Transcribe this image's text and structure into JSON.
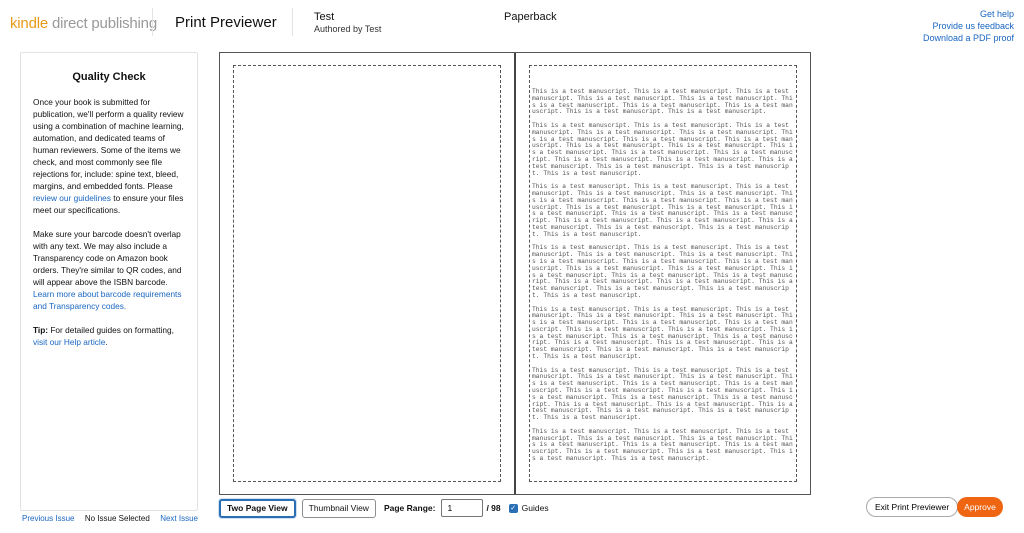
{
  "header": {
    "logo_part1": "kindle",
    "logo_part2": " direct publishing",
    "app_title": "Print Previewer",
    "book_title": "Test",
    "book_author": "Authored by Test",
    "format": "Paperback",
    "links": {
      "help": "Get help",
      "feedback": "Provide us feedback",
      "pdf_proof": "Download a PDF proof"
    }
  },
  "sidebar": {
    "title": "Quality Check",
    "p1_text": "Once your book is submitted for publication, we'll perform a quality review using a combination of machine learning, automation, and dedicated teams of human reviewers. Some of the items we check, and most commonly see file rejections for, include: spine text, bleed, margins, and embedded fonts. Please ",
    "p1_link": "review our guidelines",
    "p1_tail": " to ensure your files meet our specifications.",
    "p2_text": "Make sure your barcode doesn't overlap with any text. We may also include a Transparency code on Amazon book orders. They're similar to QR codes, and will appear above the ISBN barcode. ",
    "p2_link": "Learn more about barcode requirements and Transparency codes.",
    "tip_label": "Tip:",
    "tip_text": " For detailed guides on formatting, ",
    "tip_link": "visit our Help article",
    "tip_tail": "."
  },
  "issue_nav": {
    "previous": "Previous Issue",
    "status": "No Issue Selected",
    "next": "Next Issue"
  },
  "preview": {
    "paragraphs": [
      "This is a test manuscript. This is a test manuscript. This is a test manuscript. This is a test manuscript. This is a test manuscript. This is a test manuscript. This is a test manuscript. This is a test manuscript. This is a test manuscript. This is a test manuscript.",
      "This is a test manuscript. This is a test manuscript. This is a test manuscript. This is a test manuscript. This is a test manuscript. This is a test manuscript. This is a test manuscript. This is a test manuscript. This is a test manuscript. This is a test manuscript. This is a test manuscript. This is a test manuscript. This is a test manuscript. This is a test manuscript. This is a test manuscript. This is a test manuscript. This is a test manuscript. This is a test manuscript. This is a test manuscript.",
      "This is a test manuscript. This is a test manuscript. This is a test manuscript. This is a test manuscript. This is a test manuscript. This is a test manuscript. This is a test manuscript. This is a test manuscript. This is a test manuscript. This is a test manuscript. This is a test manuscript. This is a test manuscript. This is a test manuscript. This is a test manuscript. This is a test manuscript. This is a test manuscript. This is a test manuscript. This is a test manuscript. This is a test manuscript.",
      "This is a test manuscript. This is a test manuscript. This is a test manuscript. This is a test manuscript. This is a test manuscript. This is a test manuscript. This is a test manuscript. This is a test manuscript. This is a test manuscript. This is a test manuscript. This is a test manuscript. This is a test manuscript. This is a test manuscript. This is a test manuscript. This is a test manuscript. This is a test manuscript. This is a test manuscript. This is a test manuscript. This is a test manuscript.",
      "This is a test manuscript. This is a test manuscript. This is a test manuscript. This is a test manuscript. This is a test manuscript. This is a test manuscript. This is a test manuscript. This is a test manuscript. This is a test manuscript. This is a test manuscript. This is a test manuscript. This is a test manuscript. This is a test manuscript. This is a test manuscript. This is a test manuscript. This is a test manuscript. This is a test manuscript. This is a test manuscript. This is a test manuscript.",
      "This is a test manuscript. This is a test manuscript. This is a test manuscript. This is a test manuscript. This is a test manuscript. This is a test manuscript. This is a test manuscript. This is a test manuscript. This is a test manuscript. This is a test manuscript. This is a test manuscript. This is a test manuscript. This is a test manuscript. This is a test manuscript. This is a test manuscript. This is a test manuscript. This is a test manuscript. This is a test manuscript. This is a test manuscript.",
      "This is a test manuscript. This is a test manuscript. This is a test manuscript. This is a test manuscript. This is a test manuscript. This is a test manuscript. This is a test manuscript. This is a test manuscript. This is a test manuscript. This is a test manuscript. This is a test manuscript. This is a test manuscript."
    ]
  },
  "toolbar": {
    "two_page_view": "Two Page View",
    "thumbnail_view": "Thumbnail View",
    "page_range_label": "Page Range:",
    "page_range_value": "1",
    "page_total": "/ 98",
    "guides_label": "Guides",
    "guides_checked": true
  },
  "actions": {
    "exit": "Exit Print Previewer",
    "approve": "Approve"
  },
  "colors": {
    "accent_orange": "#ef6511",
    "link_blue": "#1a66c2",
    "active_blue": "#2a6fb6"
  }
}
